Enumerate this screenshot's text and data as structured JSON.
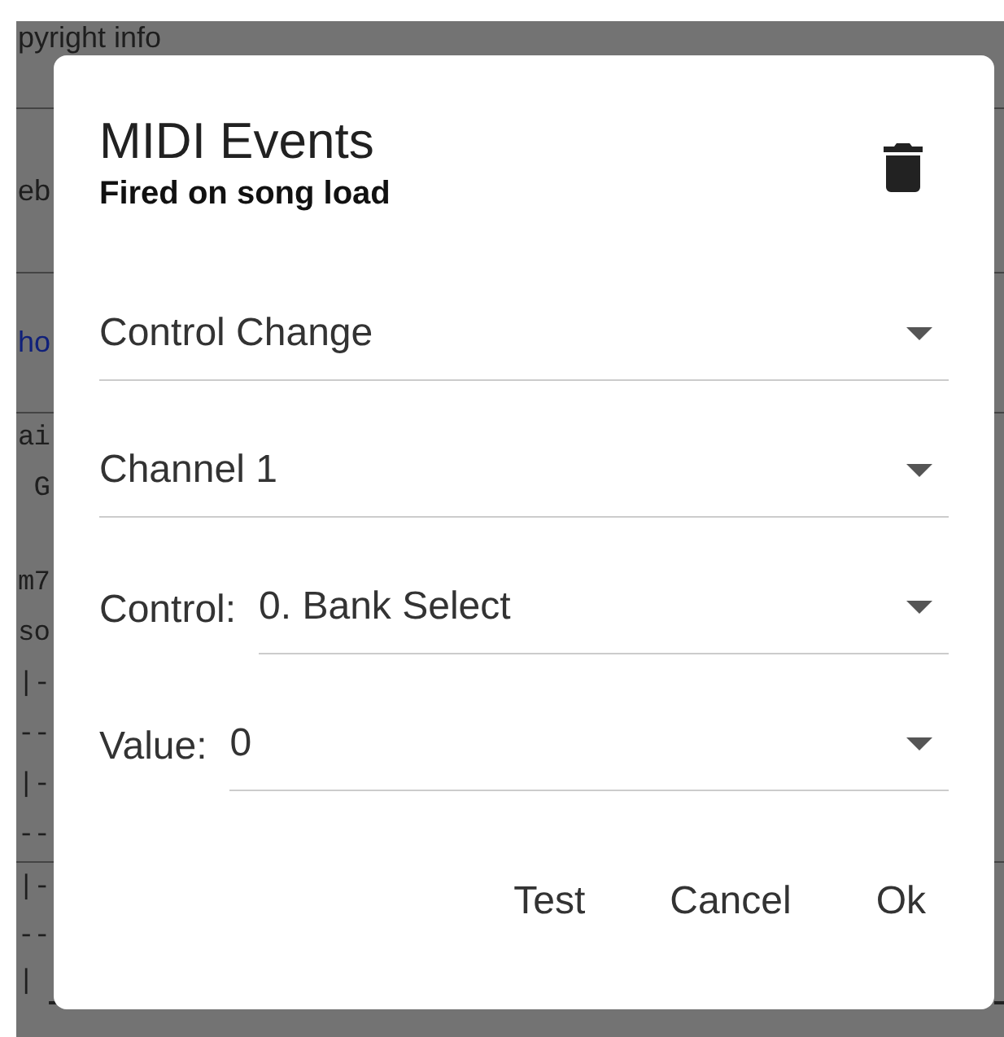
{
  "background": {
    "rows": [
      {
        "left": "pyright info",
        "kind": "text"
      },
      {
        "left": "eb",
        "kind": "text"
      },
      {
        "left": "ho",
        "kind": "link"
      },
      {
        "left": "ai",
        "kind": "mono"
      },
      {
        "left": " G",
        "kind": "mono"
      },
      {
        "left": "m7",
        "kind": "mono"
      },
      {
        "left": "so",
        "kind": "mono"
      },
      {
        "left": "|-",
        "kind": "mono"
      },
      {
        "left": "--",
        "kind": "mono"
      },
      {
        "left": "|-",
        "kind": "mono"
      },
      {
        "left": "--",
        "kind": "mono"
      },
      {
        "left": "|-",
        "kind": "mono"
      },
      {
        "left": "--",
        "kind": "mono"
      },
      {
        "left": "|",
        "kind": "mono"
      }
    ]
  },
  "dialog": {
    "title": "MIDI Events",
    "subtitle": "Fired on song load",
    "fields": [
      {
        "value": "Control Change"
      },
      {
        "value": "Channel 1"
      },
      {
        "label": "Control:",
        "value": "0. Bank Select"
      },
      {
        "label": "Value:",
        "value": "0"
      }
    ],
    "buttons": [
      "Test",
      "Cancel",
      "Ok"
    ]
  }
}
